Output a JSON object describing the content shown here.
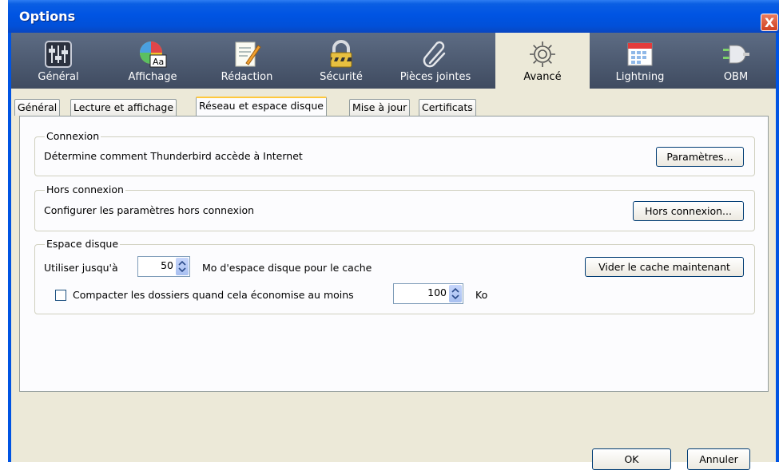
{
  "window": {
    "title": "Options",
    "close_glyph": "X"
  },
  "toolbar": {
    "items": [
      {
        "label": "Général",
        "icon": "sliders-icon"
      },
      {
        "label": "Affichage",
        "icon": "color-font-icon"
      },
      {
        "label": "Rédaction",
        "icon": "compose-icon"
      },
      {
        "label": "Sécurité",
        "icon": "lock-icon"
      },
      {
        "label": "Pièces jointes",
        "icon": "paperclip-icon"
      },
      {
        "label": "Avancé",
        "icon": "gear-icon"
      },
      {
        "label": "Lightning",
        "icon": "calendar-icon"
      },
      {
        "label": "OBM",
        "icon": "plug-icon"
      }
    ],
    "active_index": 5
  },
  "tabs": [
    "Général",
    "Lecture et affichage",
    "Réseau et espace disque",
    "Mise à jour",
    "Certificats"
  ],
  "selected_tab": 2,
  "connexion": {
    "legend": "Connexion",
    "description": "Détermine comment Thunderbird accède à Internet",
    "button": "Paramètres..."
  },
  "hors_connexion": {
    "legend": "Hors connexion",
    "description": "Configurer les paramètres hors connexion",
    "button": "Hors connexion..."
  },
  "espace_disque": {
    "legend": "Espace disque",
    "cache_label": "Utiliser jusqu'à",
    "cache_value": "50",
    "cache_suffix": "Mo d'espace disque pour le cache",
    "clear_button": "Vider le cache maintenant",
    "compact_label": "Compacter les dossiers quand cela économise au moins",
    "compact_checked": false,
    "compact_value": "100",
    "compact_unit": "Ko"
  },
  "footer": {
    "ok": "OK",
    "cancel": "Annuler"
  },
  "colors": {
    "titlebar": "#0054e3",
    "toolbar": "#4d5a72",
    "dialog_bg": "#ece9d8",
    "tab_highlight": "#ffc83c"
  }
}
